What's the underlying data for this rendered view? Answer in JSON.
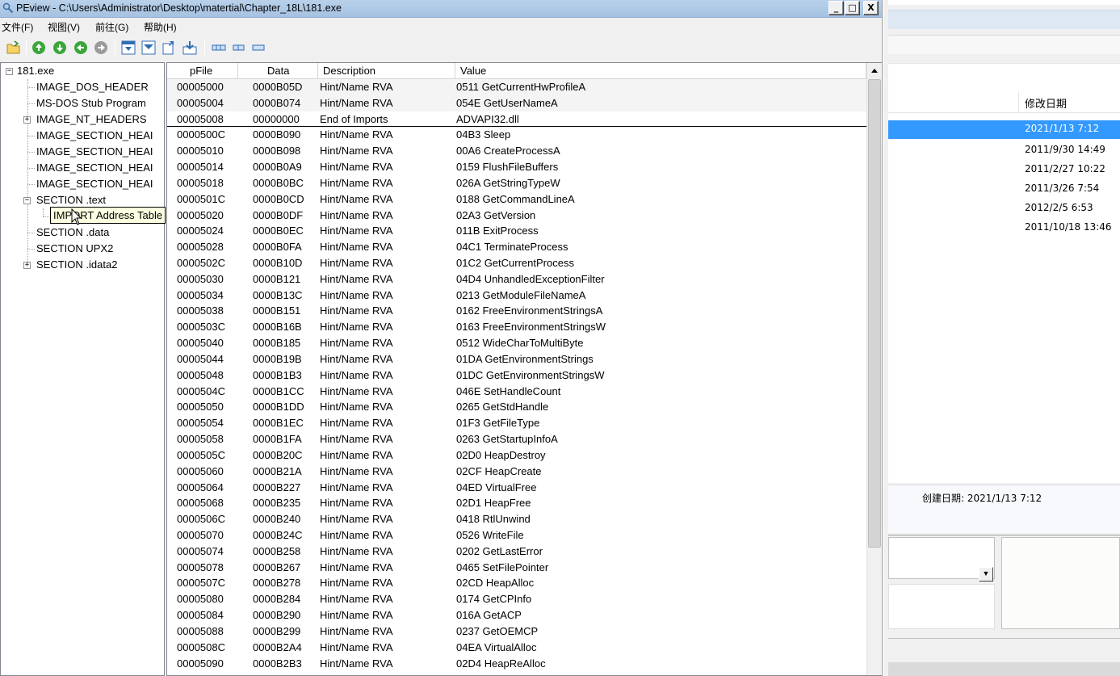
{
  "window": {
    "title": "PEview - C:\\Users\\Administrator\\Desktop\\matertial\\Chapter_18L\\181.exe",
    "controls": [
      "_",
      "□",
      "X"
    ]
  },
  "menu": [
    "文件(F)",
    "视图(V)",
    "前往(G)",
    "帮助(H)"
  ],
  "toolbar": {
    "buttons": [
      {
        "icon": "open-folder-icon"
      },
      {
        "icon": "up-arrow-icon"
      },
      {
        "icon": "down-arrow-icon"
      },
      {
        "icon": "back-arrow-icon"
      },
      {
        "icon": "forward-arrow-icon"
      },
      {
        "icon": "view-byte-icon"
      },
      {
        "icon": "view-word-icon"
      },
      {
        "icon": "view-dword-icon"
      },
      {
        "icon": "view-address-icon"
      },
      {
        "icon": "view-list-icon"
      },
      {
        "icon": "view-columns-icon"
      },
      {
        "icon": "view-narrow-icon"
      }
    ]
  },
  "tree": {
    "items": [
      {
        "label": "181.exe",
        "expander": "−"
      },
      {
        "label": "IMAGE_DOS_HEADER"
      },
      {
        "label": "MS-DOS Stub Program"
      },
      {
        "label": "IMAGE_NT_HEADERS",
        "expander": "+"
      },
      {
        "label": "IMAGE_SECTION_HEAI"
      },
      {
        "label": "IMAGE_SECTION_HEAI"
      },
      {
        "label": "IMAGE_SECTION_HEAI"
      },
      {
        "label": "IMAGE_SECTION_HEAI"
      },
      {
        "label": "SECTION .text",
        "expander": "−"
      },
      {
        "label": ""
      },
      {
        "label": "SECTION .data"
      },
      {
        "label": "SECTION UPX2"
      },
      {
        "label": "SECTION .idata2",
        "expander": "+"
      }
    ],
    "tooltip": "IMPORT Address Table"
  },
  "list": {
    "columns": [
      "pFile",
      "Data",
      "Description",
      "Value"
    ],
    "rows": [
      {
        "pfile": "00005000",
        "data": "0000B05D",
        "desc": "Hint/Name RVA",
        "value": "0511  GetCurrentHwProfileA"
      },
      {
        "pfile": "00005004",
        "data": "0000B074",
        "desc": "Hint/Name RVA",
        "value": "054E  GetUserNameA"
      },
      {
        "pfile": "00005008",
        "data": "00000000",
        "desc": "End of Imports",
        "value": "ADVAPI32.dll"
      },
      {
        "pfile": "0000500C",
        "data": "0000B090",
        "desc": "Hint/Name RVA",
        "value": "04B3  Sleep"
      },
      {
        "pfile": "00005010",
        "data": "0000B098",
        "desc": "Hint/Name RVA",
        "value": "00A6  CreateProcessA"
      },
      {
        "pfile": "00005014",
        "data": "0000B0A9",
        "desc": "Hint/Name RVA",
        "value": "0159  FlushFileBuffers"
      },
      {
        "pfile": "00005018",
        "data": "0000B0BC",
        "desc": "Hint/Name RVA",
        "value": "026A  GetStringTypeW"
      },
      {
        "pfile": "0000501C",
        "data": "0000B0CD",
        "desc": "Hint/Name RVA",
        "value": "0188  GetCommandLineA"
      },
      {
        "pfile": "00005020",
        "data": "0000B0DF",
        "desc": "Hint/Name RVA",
        "value": "02A3  GetVersion"
      },
      {
        "pfile": "00005024",
        "data": "0000B0EC",
        "desc": "Hint/Name RVA",
        "value": "011B  ExitProcess"
      },
      {
        "pfile": "00005028",
        "data": "0000B0FA",
        "desc": "Hint/Name RVA",
        "value": "04C1  TerminateProcess"
      },
      {
        "pfile": "0000502C",
        "data": "0000B10D",
        "desc": "Hint/Name RVA",
        "value": "01C2  GetCurrentProcess"
      },
      {
        "pfile": "00005030",
        "data": "0000B121",
        "desc": "Hint/Name RVA",
        "value": "04D4  UnhandledExceptionFilter"
      },
      {
        "pfile": "00005034",
        "data": "0000B13C",
        "desc": "Hint/Name RVA",
        "value": "0213  GetModuleFileNameA"
      },
      {
        "pfile": "00005038",
        "data": "0000B151",
        "desc": "Hint/Name RVA",
        "value": "0162  FreeEnvironmentStringsA"
      },
      {
        "pfile": "0000503C",
        "data": "0000B16B",
        "desc": "Hint/Name RVA",
        "value": "0163  FreeEnvironmentStringsW"
      },
      {
        "pfile": "00005040",
        "data": "0000B185",
        "desc": "Hint/Name RVA",
        "value": "0512  WideCharToMultiByte"
      },
      {
        "pfile": "00005044",
        "data": "0000B19B",
        "desc": "Hint/Name RVA",
        "value": "01DA  GetEnvironmentStrings"
      },
      {
        "pfile": "00005048",
        "data": "0000B1B3",
        "desc": "Hint/Name RVA",
        "value": "01DC  GetEnvironmentStringsW"
      },
      {
        "pfile": "0000504C",
        "data": "0000B1CC",
        "desc": "Hint/Name RVA",
        "value": "046E  SetHandleCount"
      },
      {
        "pfile": "00005050",
        "data": "0000B1DD",
        "desc": "Hint/Name RVA",
        "value": "0265  GetStdHandle"
      },
      {
        "pfile": "00005054",
        "data": "0000B1EC",
        "desc": "Hint/Name RVA",
        "value": "01F3  GetFileType"
      },
      {
        "pfile": "00005058",
        "data": "0000B1FA",
        "desc": "Hint/Name RVA",
        "value": "0263  GetStartupInfoA"
      },
      {
        "pfile": "0000505C",
        "data": "0000B20C",
        "desc": "Hint/Name RVA",
        "value": "02D0  HeapDestroy"
      },
      {
        "pfile": "00005060",
        "data": "0000B21A",
        "desc": "Hint/Name RVA",
        "value": "02CF  HeapCreate"
      },
      {
        "pfile": "00005064",
        "data": "0000B227",
        "desc": "Hint/Name RVA",
        "value": "04ED  VirtualFree"
      },
      {
        "pfile": "00005068",
        "data": "0000B235",
        "desc": "Hint/Name RVA",
        "value": "02D1  HeapFree"
      },
      {
        "pfile": "0000506C",
        "data": "0000B240",
        "desc": "Hint/Name RVA",
        "value": "0418  RtlUnwind"
      },
      {
        "pfile": "00005070",
        "data": "0000B24C",
        "desc": "Hint/Name RVA",
        "value": "0526  WriteFile"
      },
      {
        "pfile": "00005074",
        "data": "0000B258",
        "desc": "Hint/Name RVA",
        "value": "0202  GetLastError"
      },
      {
        "pfile": "00005078",
        "data": "0000B267",
        "desc": "Hint/Name RVA",
        "value": "0465  SetFilePointer"
      },
      {
        "pfile": "0000507C",
        "data": "0000B278",
        "desc": "Hint/Name RVA",
        "value": "02CD  HeapAlloc"
      },
      {
        "pfile": "00005080",
        "data": "0000B284",
        "desc": "Hint/Name RVA",
        "value": "0174  GetCPInfo"
      },
      {
        "pfile": "00005084",
        "data": "0000B290",
        "desc": "Hint/Name RVA",
        "value": "016A  GetACP"
      },
      {
        "pfile": "00005088",
        "data": "0000B299",
        "desc": "Hint/Name RVA",
        "value": "0237  GetOEMCP"
      },
      {
        "pfile": "0000508C",
        "data": "0000B2A4",
        "desc": "Hint/Name RVA",
        "value": "04EA  VirtualAlloc"
      },
      {
        "pfile": "00005090",
        "data": "0000B2B3",
        "desc": "Hint/Name RVA",
        "value": "02D4  HeapReAlloc"
      }
    ]
  },
  "explorer": {
    "column_header": "修改日期",
    "dates": [
      "2021/1/13 7:12",
      "2011/9/30 14:49",
      "2011/2/27 10:22",
      "2011/3/26 7:54",
      "2012/2/5 6:53",
      "2011/10/18 13:46"
    ],
    "detail": "创建日期: 2021/1/13 7:12"
  },
  "colors": {
    "titlebar": "#b9d1ea",
    "selection": "#3399ff",
    "tooltip_bg": "#ffffe1"
  }
}
